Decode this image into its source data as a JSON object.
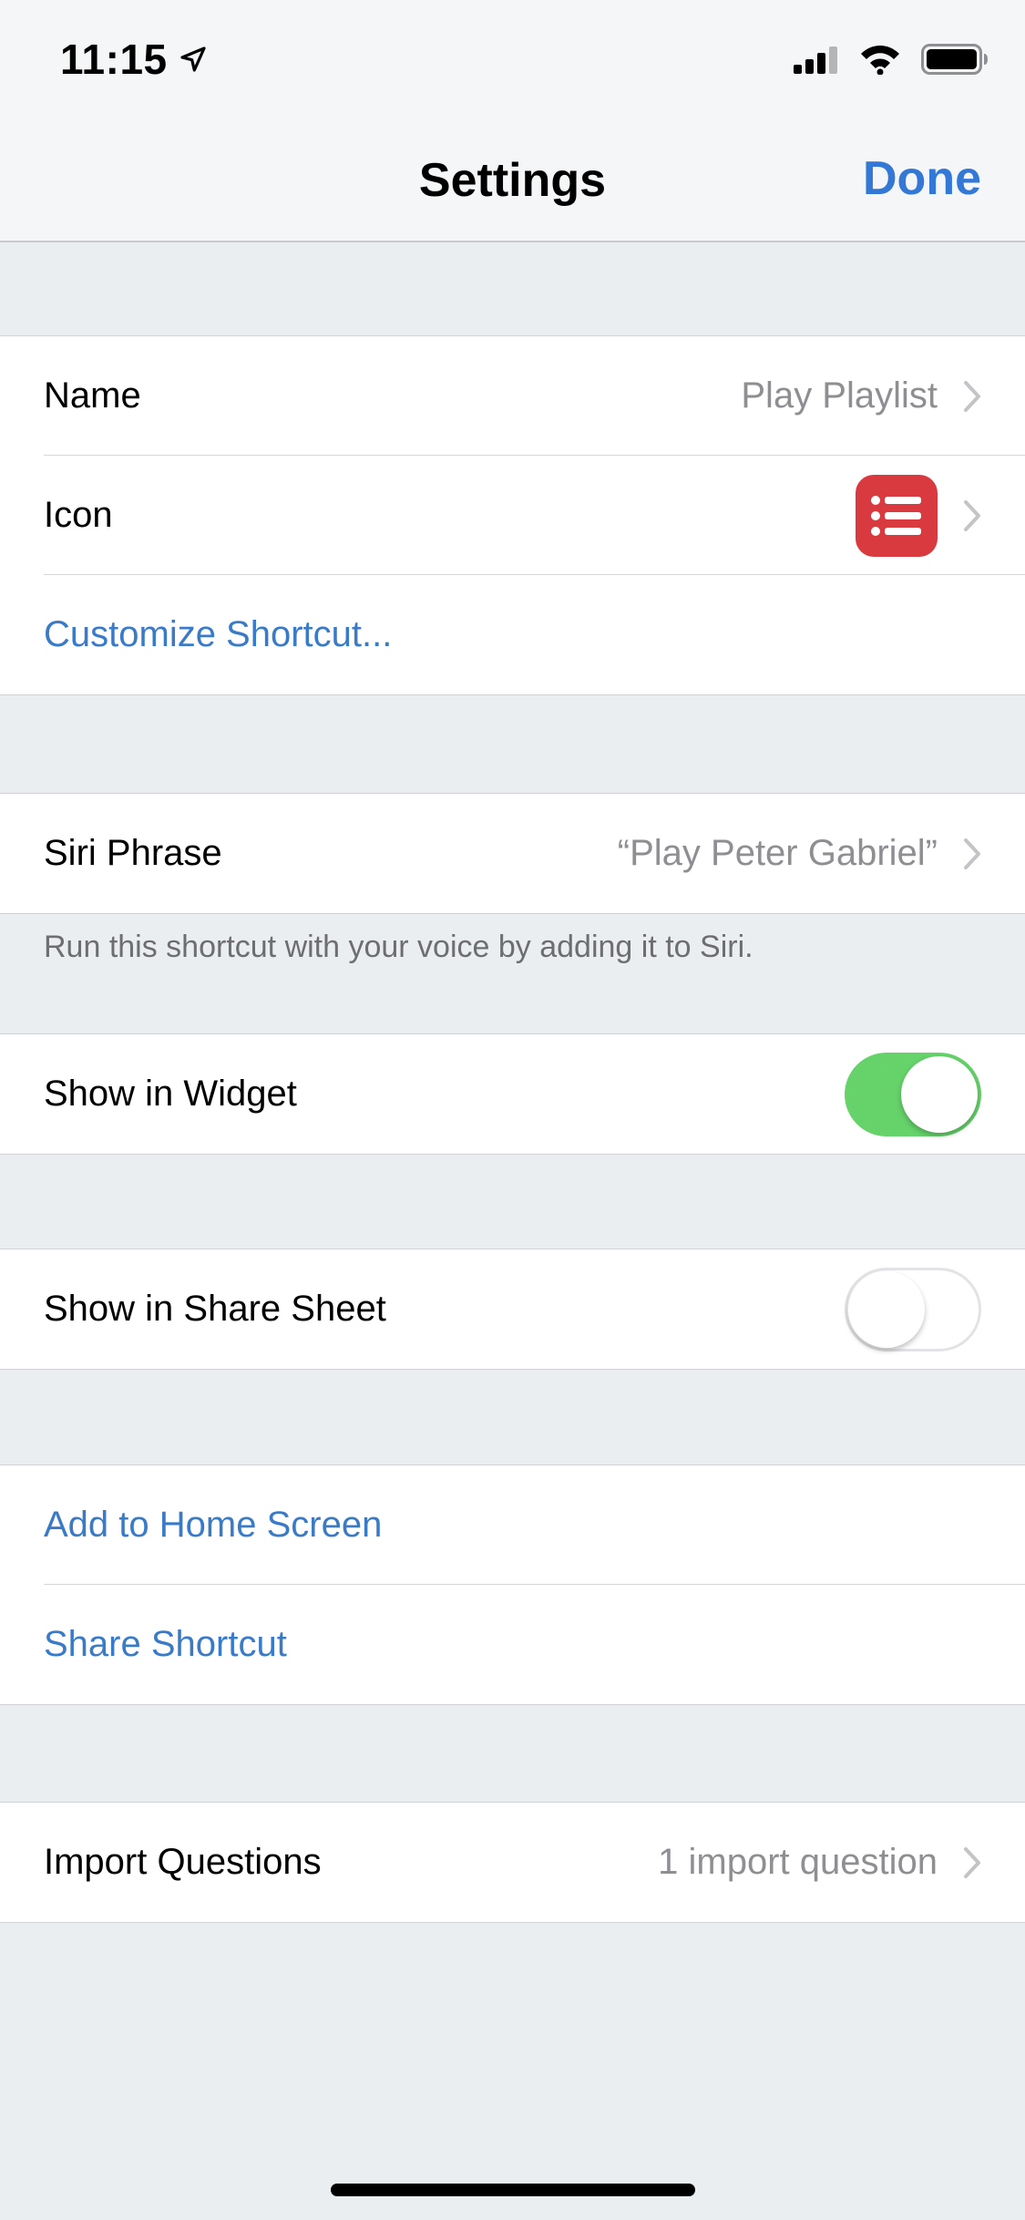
{
  "status_bar": {
    "time": "11:15"
  },
  "nav": {
    "title": "Settings",
    "done_label": "Done"
  },
  "group1": {
    "name_label": "Name",
    "name_value": "Play Playlist",
    "icon_label": "Icon",
    "customize_label": "Customize Shortcut..."
  },
  "siri": {
    "label": "Siri Phrase",
    "value": "“Play Peter Gabriel”",
    "footnote": "Run this shortcut with your voice by adding it to Siri."
  },
  "widget": {
    "label": "Show in Widget",
    "enabled": true
  },
  "share_sheet": {
    "label": "Show in Share Sheet",
    "enabled": false
  },
  "actions": {
    "add_home_label": "Add to Home Screen",
    "share_label": "Share Shortcut"
  },
  "import": {
    "label": "Import Questions",
    "value": "1 import question"
  },
  "colors": {
    "accent": "#3478d6",
    "toggle_on": "#65d26a",
    "icon_bg": "#d93a3f"
  }
}
